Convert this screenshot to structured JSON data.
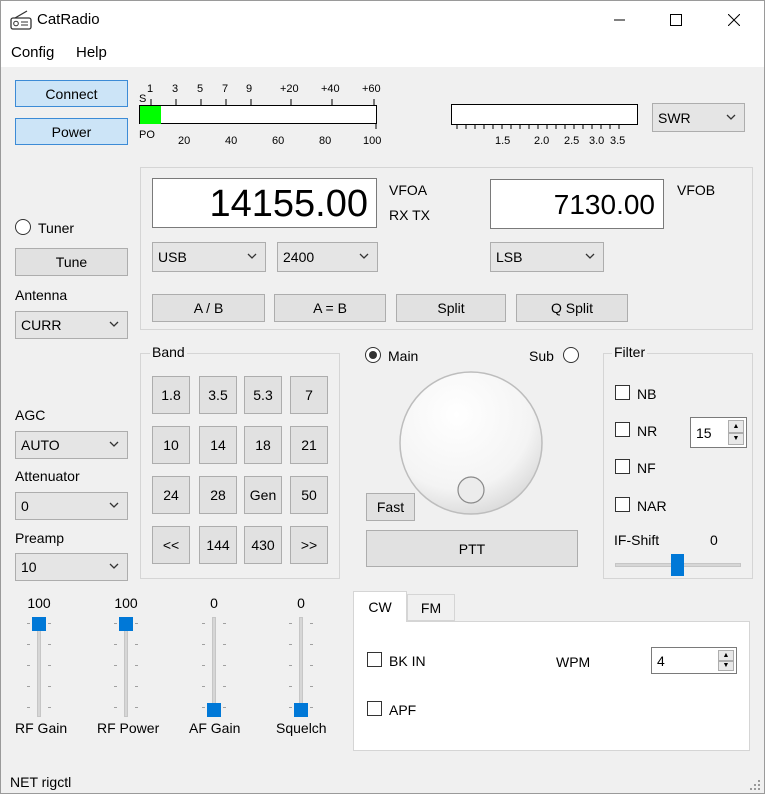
{
  "window": {
    "title": "CatRadio",
    "minimize_icon": "minimize-icon",
    "maximize_icon": "maximize-icon",
    "close_icon": "close-icon"
  },
  "menu": [
    "Config",
    "Help"
  ],
  "buttons": {
    "connect": "Connect",
    "power": "Power",
    "tune": "Tune",
    "ab_swap": "A / B",
    "ab_equal": "A = B",
    "split": "Split",
    "qsplit": "Q Split",
    "fast": "Fast",
    "ptt": "PTT"
  },
  "meter": {
    "s_scale_label": "S",
    "s_ticks": [
      "1",
      "3",
      "5",
      "7",
      "9",
      "+20",
      "+40",
      "+60"
    ],
    "po_label": "PO",
    "po_ticks": [
      "20",
      "40",
      "60",
      "80",
      "100"
    ],
    "level": 0.09,
    "level_color": "#00ff00",
    "swr_ticks": [
      "1.5",
      "2.0",
      "2.5",
      "3.0",
      "3.5"
    ],
    "meter_select": "SWR"
  },
  "vfoa": {
    "label": "VFOA",
    "rxtx": "RX TX",
    "freq": "14155.00",
    "mode": "USB",
    "bandwidth": "2400"
  },
  "vfob": {
    "label": "VFOB",
    "freq": "7130.00",
    "mode": "LSB"
  },
  "left": {
    "tuner_label": "Tuner",
    "antenna_label": "Antenna",
    "antenna_value": "CURR",
    "agc_label": "AGC",
    "agc_value": "AUTO",
    "att_label": "Attenuator",
    "att_value": "0",
    "preamp_label": "Preamp",
    "preamp_value": "10"
  },
  "band": {
    "title": "Band",
    "buttons": [
      "1.8",
      "3.5",
      "5.3",
      "7",
      "10",
      "14",
      "18",
      "21",
      "24",
      "28",
      "Gen",
      "50",
      "<<",
      "144",
      "430",
      ">>"
    ]
  },
  "vfo_select": {
    "main": "Main",
    "sub": "Sub",
    "selected": "Main"
  },
  "filter": {
    "title": "Filter",
    "nb": "NB",
    "nr": "NR",
    "nr_value": "15",
    "nf": "NF",
    "nar": "NAR",
    "ifshift_label": "IF-Shift",
    "ifshift_value": "0"
  },
  "sliders": [
    {
      "label": "RF Gain",
      "value": "100",
      "level": 1.0
    },
    {
      "label": "RF Power",
      "value": "100",
      "level": 1.0
    },
    {
      "label": "AF Gain",
      "value": "0",
      "level": 0.0
    },
    {
      "label": "Squelch",
      "value": "0",
      "level": 0.0
    }
  ],
  "tabs": {
    "items": [
      "CW",
      "FM"
    ],
    "active": "CW",
    "bkin": "BK IN",
    "apf": "APF",
    "wpm_label": "WPM",
    "wpm_value": "4"
  },
  "status": {
    "text": "NET rigctl"
  },
  "colors": {
    "accent": "#0078d7",
    "button_highlight": "#cce4f7"
  }
}
